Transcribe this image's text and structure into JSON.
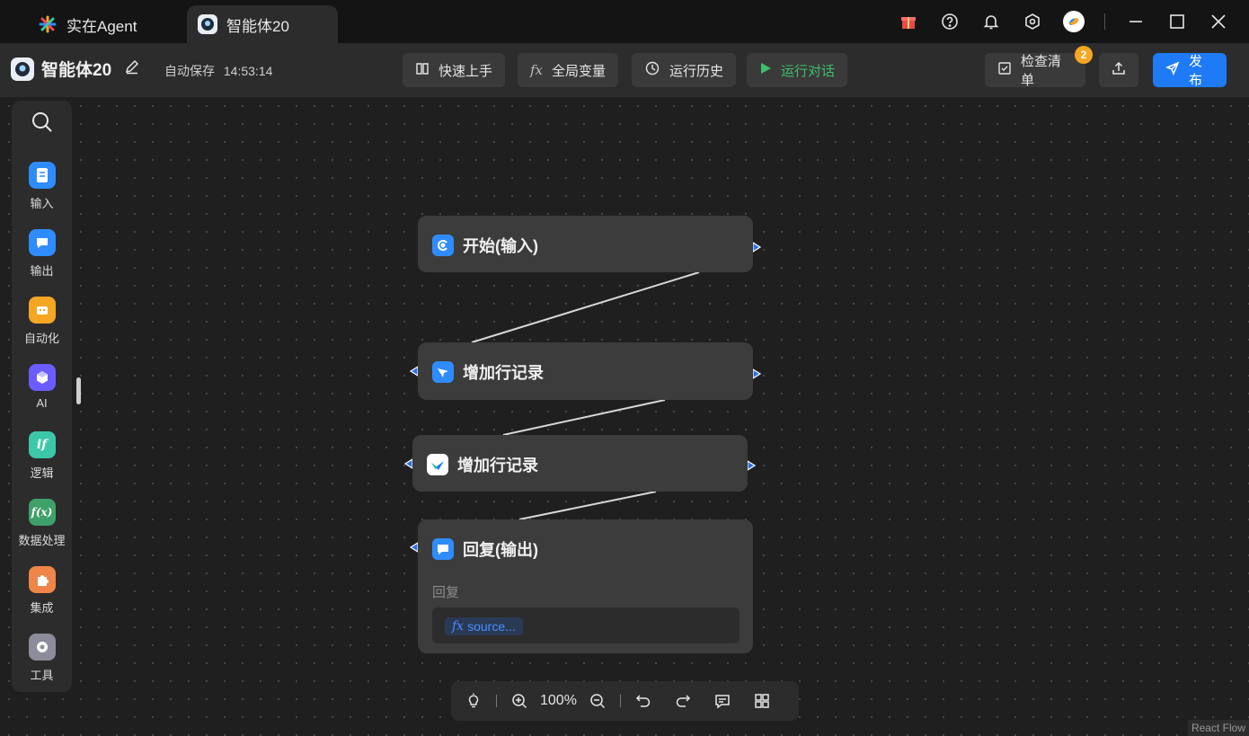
{
  "tabs": [
    {
      "label": "实在Agent"
    },
    {
      "label": "智能体20"
    }
  ],
  "toolbar": {
    "title": "智能体20",
    "autosave_label": "自动保存",
    "autosave_time": "14:53:14",
    "quick_start": "快速上手",
    "global_vars": "全局变量",
    "run_history": "运行历史",
    "run_chat": "运行对话",
    "checklist": "检查清单",
    "checklist_badge": "2",
    "publish": "发布"
  },
  "sidebar": {
    "items": [
      {
        "label": "输入",
        "icon": "doc-icon",
        "color": "#2f8cff"
      },
      {
        "label": "输出",
        "icon": "chat-icon",
        "color": "#2f8cff"
      },
      {
        "label": "自动化",
        "icon": "robot-icon",
        "color": "#f5a623"
      },
      {
        "label": "AI",
        "icon": "cube-icon",
        "color": "#6a5cff"
      },
      {
        "label": "逻辑",
        "icon": "if-icon",
        "color": "#3cc8a8"
      },
      {
        "label": "数据处理",
        "icon": "function-icon",
        "color": "#3fa06a"
      },
      {
        "label": "集成",
        "icon": "puzzle-icon",
        "color": "#f0854a"
      },
      {
        "label": "工具",
        "icon": "gear-icon",
        "color": "#8c8c9a"
      }
    ]
  },
  "nodes": [
    {
      "title": "开始(输入)",
      "icon": "start-icon"
    },
    {
      "title": "增加行记录",
      "icon": "feishu-icon"
    },
    {
      "title": "增加行记录",
      "icon": "table-app-icon"
    },
    {
      "title": "回复(输出)",
      "icon": "chat-icon",
      "field_label": "回复",
      "field_value": "source..."
    }
  ],
  "controls": {
    "zoom": "100%"
  },
  "attribution": "React Flow",
  "colors": {
    "accent": "#1e7bf5",
    "run": "#3fbf6a",
    "badge": "#f5a623"
  }
}
